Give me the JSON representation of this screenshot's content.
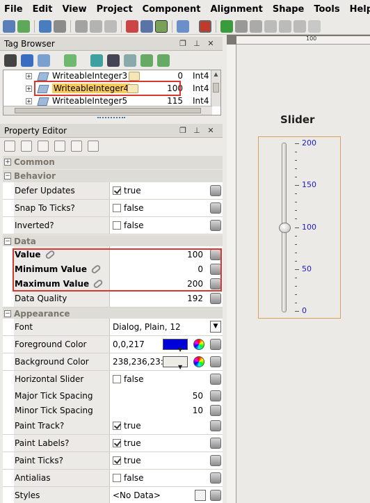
{
  "menu": [
    "File",
    "Edit",
    "View",
    "Project",
    "Component",
    "Alignment",
    "Shape",
    "Tools",
    "Help"
  ],
  "tag_browser": {
    "title": "Tag Browser",
    "rows": [
      {
        "name": "WriteableInteger3",
        "value": "0",
        "type": "Int4"
      },
      {
        "name": "WriteableInteger4",
        "value": "100",
        "type": "Int4",
        "selected": true
      },
      {
        "name": "WriteableInteger5",
        "value": "115",
        "type": "Int4"
      }
    ]
  },
  "property_editor": {
    "title": "Property Editor",
    "categories": {
      "common": "Common",
      "behavior": "Behavior",
      "data": "Data",
      "appearance": "Appearance"
    },
    "behavior": [
      {
        "name": "Defer Updates",
        "checked": true,
        "value": "true"
      },
      {
        "name": "Snap To Ticks?",
        "checked": false,
        "value": "false"
      },
      {
        "name": "Inverted?",
        "checked": false,
        "value": "false"
      }
    ],
    "data": [
      {
        "name": "Value",
        "value": "100"
      },
      {
        "name": "Minimum Value",
        "value": "0"
      },
      {
        "name": "Maximum Value",
        "value": "200"
      },
      {
        "name": "Data Quality",
        "value": "192"
      }
    ],
    "appearance": {
      "font": {
        "name": "Font",
        "value": "Dialog, Plain, 12"
      },
      "foreground": {
        "name": "Foreground Color",
        "value": "0,0,217",
        "color": "#0000d9"
      },
      "background": {
        "name": "Background Color",
        "value": "238,236,23:",
        "color": "#eeece6"
      },
      "horizontal": {
        "name": "Horizontal Slider",
        "checked": false,
        "value": "false"
      },
      "major": {
        "name": "Major Tick Spacing",
        "value": "50"
      },
      "minor": {
        "name": "Minor Tick Spacing",
        "value": "10"
      },
      "paint_track": {
        "name": "Paint Track?",
        "checked": true,
        "value": "true"
      },
      "paint_labels": {
        "name": "Paint Labels?",
        "checked": true,
        "value": "true"
      },
      "paint_ticks": {
        "name": "Paint Ticks?",
        "checked": true,
        "value": "true"
      },
      "antialias": {
        "name": "Antialias",
        "checked": false,
        "value": "false"
      },
      "styles": {
        "name": "Styles",
        "value": "<No Data>"
      }
    }
  },
  "canvas": {
    "ruler_label": "100",
    "slider": {
      "title": "Slider",
      "min": 0,
      "max": 200,
      "value": 100,
      "labels": [
        "200",
        "150",
        "100",
        "50",
        "0"
      ],
      "label_color": "#1a1ac8"
    }
  }
}
